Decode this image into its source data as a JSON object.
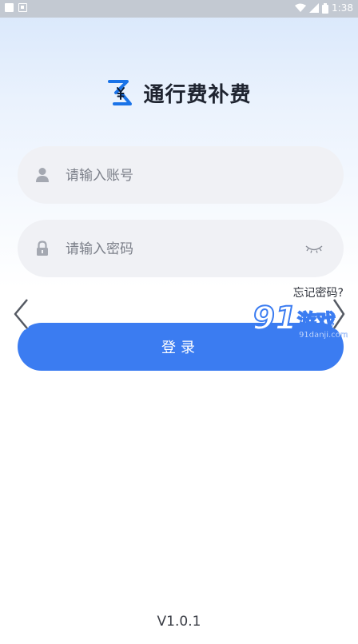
{
  "status_bar": {
    "time": "1:38"
  },
  "app": {
    "title": "通行费补费"
  },
  "login_form": {
    "account_placeholder": "请输入账号",
    "password_placeholder": "请输入密码",
    "forgot_label": "忘记密码?",
    "login_label": "登录"
  },
  "watermark": {
    "number": "91",
    "text": "游戏",
    "url": "91danji.com"
  },
  "footer": {
    "version": "V1.0.1"
  },
  "colors": {
    "accent": "#3b7cf1",
    "field_bg": "#f0f1f5"
  }
}
